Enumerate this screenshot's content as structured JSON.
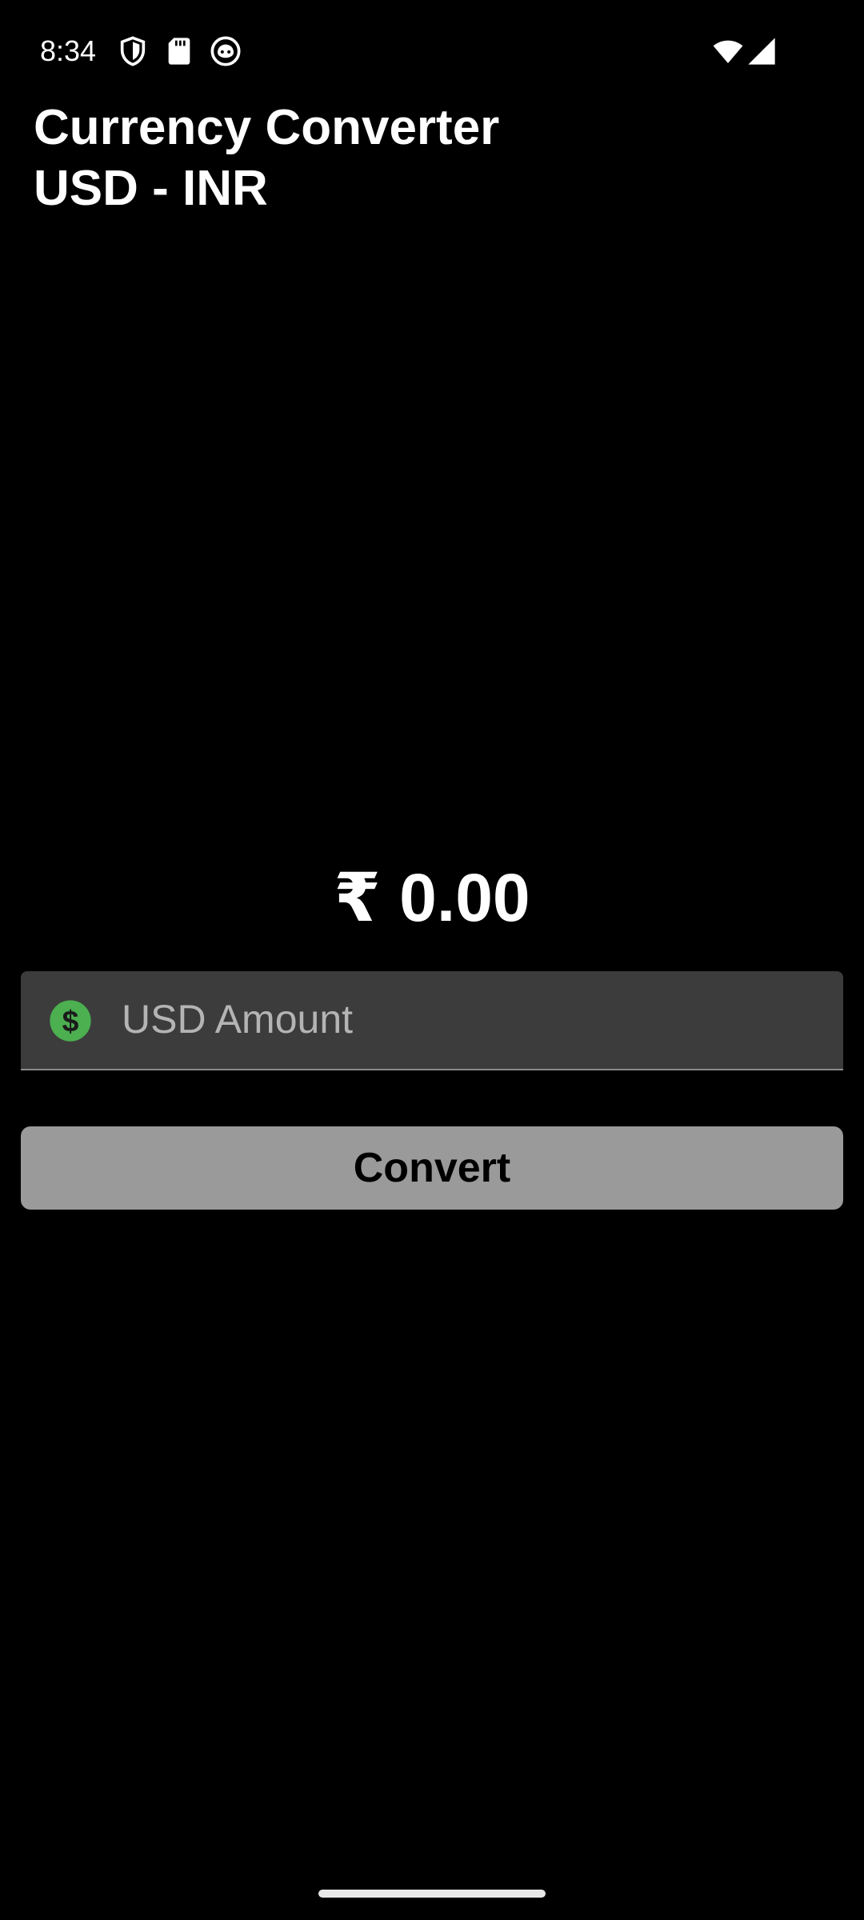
{
  "status_bar": {
    "time": "8:34",
    "icons": [
      "shield-icon",
      "sd-card-icon",
      "notification-app-icon",
      "wifi-icon",
      "cellular-signal-icon"
    ]
  },
  "app": {
    "title_line1": "Currency Converter",
    "title_line2": "USD - INR"
  },
  "result": {
    "display": "₹ 0.00"
  },
  "amount_input": {
    "value": "",
    "placeholder": "USD Amount",
    "icon": "dollar-circle-icon"
  },
  "convert_button": {
    "label": "Convert"
  },
  "colors": {
    "background": "#000000",
    "input_background": "#3c3c3c",
    "button_background": "#9a9a9a",
    "dollar_icon": "#4caf50"
  }
}
